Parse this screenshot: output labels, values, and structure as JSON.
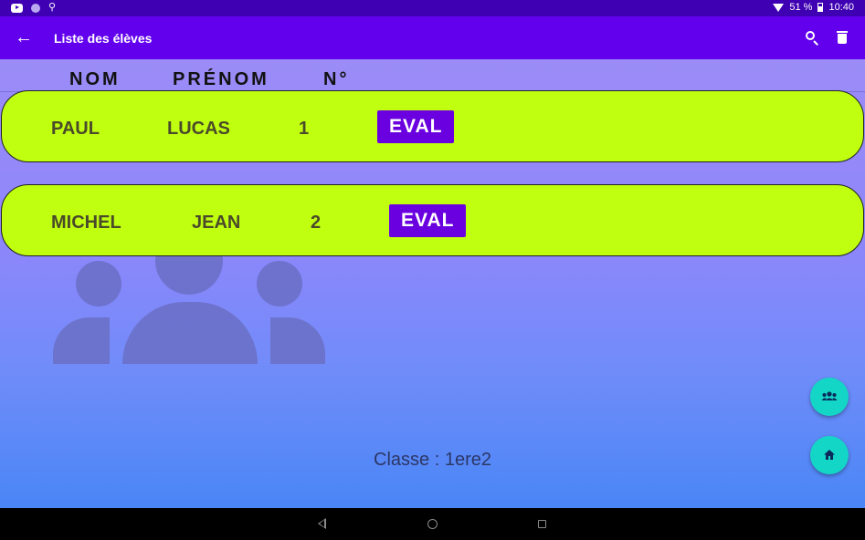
{
  "status_bar": {
    "battery": "51 %",
    "time": "10:40",
    "icons": [
      "youtube-icon",
      "notification-dot-icon",
      "usb-icon",
      "wifi-icon",
      "battery-icon"
    ]
  },
  "app_bar": {
    "title": "Liste des élèves",
    "icons": [
      "back-arrow-icon",
      "search-icon",
      "trash-icon"
    ]
  },
  "table": {
    "headers": [
      "NOM",
      "PRÉNOM",
      "N°"
    ],
    "rows": [
      {
        "nom": "PAUL",
        "prenom": "LUCAS",
        "numero": "1",
        "action": "EVAL"
      },
      {
        "nom": "MICHEL",
        "prenom": "JEAN",
        "numero": "2",
        "action": "EVAL"
      }
    ]
  },
  "class_label": "Classe : 1ere2",
  "fabs": {
    "group_icon": "group-icon",
    "home_icon": "home-icon"
  },
  "colors": {
    "status_bar": "#3f00b3",
    "app_bar": "#6200ee",
    "card": "#c0ff0f",
    "eval_button": "#6a00e0",
    "fab": "#14d6c7"
  }
}
